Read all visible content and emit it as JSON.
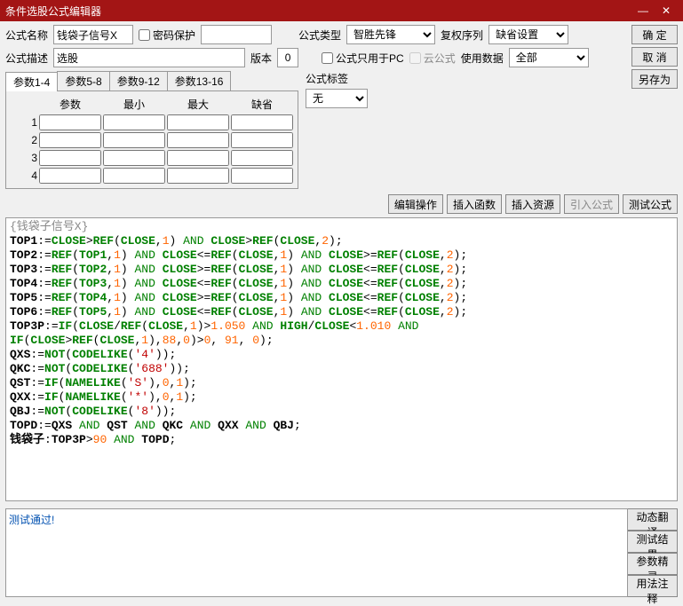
{
  "window": {
    "title": "条件选股公式编辑器"
  },
  "labels": {
    "name": "公式名称",
    "pwd": "密码保护",
    "type": "公式类型",
    "right": "复权序列",
    "desc": "公式描述",
    "ver": "版本",
    "pconly": "公式只用于PC",
    "cloud": "云公式",
    "usedata": "使用数据",
    "tag": "公式标签",
    "param": "参数",
    "min": "最小",
    "max": "最大",
    "def": "缺省"
  },
  "values": {
    "name": "钱袋子信号X",
    "desc": "选股",
    "ver": "0",
    "type": "智胜先锋",
    "right": "缺省设置",
    "usedata": "全部",
    "tag": "无"
  },
  "buttons": {
    "ok": "确 定",
    "cancel": "取 消",
    "saveas": "另存为",
    "editop": "编辑操作",
    "insfun": "插入函数",
    "insres": "插入资源",
    "impf": "引入公式",
    "testf": "测试公式",
    "dyntr": "动态翻译",
    "testres": "测试结果",
    "parwiz": "参数精灵",
    "usage": "用法注释"
  },
  "tabs": [
    "参数1-4",
    "参数5-8",
    "参数9-12",
    "参数13-16"
  ],
  "test_output": "测试通过!",
  "code_title": "{钱袋子信号X}",
  "code": [
    [
      [
        "id",
        "TOP1"
      ],
      [
        "op",
        ":="
      ],
      [
        "f",
        "CLOSE"
      ],
      [
        "op",
        ">"
      ],
      [
        "f",
        "REF"
      ],
      [
        "op",
        "("
      ],
      [
        "f",
        "CLOSE"
      ],
      [
        "op",
        ","
      ],
      [
        "n",
        "1"
      ],
      [
        "op",
        ") "
      ],
      [
        "k",
        "AND"
      ],
      [
        "op",
        " "
      ],
      [
        "f",
        "CLOSE"
      ],
      [
        "op",
        ">"
      ],
      [
        "f",
        "REF"
      ],
      [
        "op",
        "("
      ],
      [
        "f",
        "CLOSE"
      ],
      [
        "op",
        ","
      ],
      [
        "n",
        "2"
      ],
      [
        "op",
        ");"
      ]
    ],
    [
      [
        "id",
        "TOP2"
      ],
      [
        "op",
        ":="
      ],
      [
        "f",
        "REF"
      ],
      [
        "op",
        "("
      ],
      [
        "f",
        "TOP1"
      ],
      [
        "op",
        ","
      ],
      [
        "n",
        "1"
      ],
      [
        "op",
        ") "
      ],
      [
        "k",
        "AND"
      ],
      [
        "op",
        " "
      ],
      [
        "f",
        "CLOSE"
      ],
      [
        "op",
        "<="
      ],
      [
        "f",
        "REF"
      ],
      [
        "op",
        "("
      ],
      [
        "f",
        "CLOSE"
      ],
      [
        "op",
        ","
      ],
      [
        "n",
        "1"
      ],
      [
        "op",
        ") "
      ],
      [
        "k",
        "AND"
      ],
      [
        "op",
        " "
      ],
      [
        "f",
        "CLOSE"
      ],
      [
        "op",
        ">="
      ],
      [
        "f",
        "REF"
      ],
      [
        "op",
        "("
      ],
      [
        "f",
        "CLOSE"
      ],
      [
        "op",
        ","
      ],
      [
        "n",
        "2"
      ],
      [
        "op",
        ");"
      ]
    ],
    [
      [
        "id",
        "TOP3"
      ],
      [
        "op",
        ":="
      ],
      [
        "f",
        "REF"
      ],
      [
        "op",
        "("
      ],
      [
        "f",
        "TOP2"
      ],
      [
        "op",
        ","
      ],
      [
        "n",
        "1"
      ],
      [
        "op",
        ") "
      ],
      [
        "k",
        "AND"
      ],
      [
        "op",
        " "
      ],
      [
        "f",
        "CLOSE"
      ],
      [
        "op",
        ">="
      ],
      [
        "f",
        "REF"
      ],
      [
        "op",
        "("
      ],
      [
        "f",
        "CLOSE"
      ],
      [
        "op",
        ","
      ],
      [
        "n",
        "1"
      ],
      [
        "op",
        ") "
      ],
      [
        "k",
        "AND"
      ],
      [
        "op",
        " "
      ],
      [
        "f",
        "CLOSE"
      ],
      [
        "op",
        "<="
      ],
      [
        "f",
        "REF"
      ],
      [
        "op",
        "("
      ],
      [
        "f",
        "CLOSE"
      ],
      [
        "op",
        ","
      ],
      [
        "n",
        "2"
      ],
      [
        "op",
        ");"
      ]
    ],
    [
      [
        "id",
        "TOP4"
      ],
      [
        "op",
        ":="
      ],
      [
        "f",
        "REF"
      ],
      [
        "op",
        "("
      ],
      [
        "f",
        "TOP3"
      ],
      [
        "op",
        ","
      ],
      [
        "n",
        "1"
      ],
      [
        "op",
        ") "
      ],
      [
        "k",
        "AND"
      ],
      [
        "op",
        " "
      ],
      [
        "f",
        "CLOSE"
      ],
      [
        "op",
        "<="
      ],
      [
        "f",
        "REF"
      ],
      [
        "op",
        "("
      ],
      [
        "f",
        "CLOSE"
      ],
      [
        "op",
        ","
      ],
      [
        "n",
        "1"
      ],
      [
        "op",
        ") "
      ],
      [
        "k",
        "AND"
      ],
      [
        "op",
        " "
      ],
      [
        "f",
        "CLOSE"
      ],
      [
        "op",
        "<="
      ],
      [
        "f",
        "REF"
      ],
      [
        "op",
        "("
      ],
      [
        "f",
        "CLOSE"
      ],
      [
        "op",
        ","
      ],
      [
        "n",
        "2"
      ],
      [
        "op",
        ");"
      ]
    ],
    [
      [
        "id",
        "TOP5"
      ],
      [
        "op",
        ":="
      ],
      [
        "f",
        "REF"
      ],
      [
        "op",
        "("
      ],
      [
        "f",
        "TOP4"
      ],
      [
        "op",
        ","
      ],
      [
        "n",
        "1"
      ],
      [
        "op",
        ") "
      ],
      [
        "k",
        "AND"
      ],
      [
        "op",
        " "
      ],
      [
        "f",
        "CLOSE"
      ],
      [
        "op",
        ">="
      ],
      [
        "f",
        "REF"
      ],
      [
        "op",
        "("
      ],
      [
        "f",
        "CLOSE"
      ],
      [
        "op",
        ","
      ],
      [
        "n",
        "1"
      ],
      [
        "op",
        ") "
      ],
      [
        "k",
        "AND"
      ],
      [
        "op",
        " "
      ],
      [
        "f",
        "CLOSE"
      ],
      [
        "op",
        "<="
      ],
      [
        "f",
        "REF"
      ],
      [
        "op",
        "("
      ],
      [
        "f",
        "CLOSE"
      ],
      [
        "op",
        ","
      ],
      [
        "n",
        "2"
      ],
      [
        "op",
        ");"
      ]
    ],
    [
      [
        "id",
        "TOP6"
      ],
      [
        "op",
        ":="
      ],
      [
        "f",
        "REF"
      ],
      [
        "op",
        "("
      ],
      [
        "f",
        "TOP5"
      ],
      [
        "op",
        ","
      ],
      [
        "n",
        "1"
      ],
      [
        "op",
        ") "
      ],
      [
        "k",
        "AND"
      ],
      [
        "op",
        " "
      ],
      [
        "f",
        "CLOSE"
      ],
      [
        "op",
        "<="
      ],
      [
        "f",
        "REF"
      ],
      [
        "op",
        "("
      ],
      [
        "f",
        "CLOSE"
      ],
      [
        "op",
        ","
      ],
      [
        "n",
        "1"
      ],
      [
        "op",
        ") "
      ],
      [
        "k",
        "AND"
      ],
      [
        "op",
        " "
      ],
      [
        "f",
        "CLOSE"
      ],
      [
        "op",
        "<="
      ],
      [
        "f",
        "REF"
      ],
      [
        "op",
        "("
      ],
      [
        "f",
        "CLOSE"
      ],
      [
        "op",
        ","
      ],
      [
        "n",
        "2"
      ],
      [
        "op",
        ");"
      ]
    ],
    [
      [
        "id",
        "TOP3P"
      ],
      [
        "op",
        ":="
      ],
      [
        "f",
        "IF"
      ],
      [
        "op",
        "("
      ],
      [
        "f",
        "CLOSE"
      ],
      [
        "op",
        "/"
      ],
      [
        "f",
        "REF"
      ],
      [
        "op",
        "("
      ],
      [
        "f",
        "CLOSE"
      ],
      [
        "op",
        ","
      ],
      [
        "n",
        "1"
      ],
      [
        "op",
        ")>"
      ],
      [
        "n",
        "1.050"
      ],
      [
        "op",
        " "
      ],
      [
        "k",
        "AND"
      ],
      [
        "op",
        " "
      ],
      [
        "f",
        "HIGH"
      ],
      [
        "op",
        "/"
      ],
      [
        "f",
        "CLOSE"
      ],
      [
        "op",
        "<"
      ],
      [
        "n",
        "1.010"
      ],
      [
        "op",
        " "
      ],
      [
        "k",
        "AND"
      ]
    ],
    [
      [
        "f",
        "IF"
      ],
      [
        "op",
        "("
      ],
      [
        "f",
        "CLOSE"
      ],
      [
        "op",
        ">"
      ],
      [
        "f",
        "REF"
      ],
      [
        "op",
        "("
      ],
      [
        "f",
        "CLOSE"
      ],
      [
        "op",
        ","
      ],
      [
        "n",
        "1"
      ],
      [
        "op",
        "),"
      ],
      [
        "n",
        "88"
      ],
      [
        "op",
        ","
      ],
      [
        "n",
        "0"
      ],
      [
        "op",
        ")>"
      ],
      [
        "n",
        "0"
      ],
      [
        "op",
        ", "
      ],
      [
        "n",
        "91"
      ],
      [
        "op",
        ", "
      ],
      [
        "n",
        "0"
      ],
      [
        "op",
        ");"
      ]
    ],
    [
      [
        "id",
        "QXS"
      ],
      [
        "op",
        ":="
      ],
      [
        "f",
        "NOT"
      ],
      [
        "op",
        "("
      ],
      [
        "f",
        "CODELIKE"
      ],
      [
        "op",
        "("
      ],
      [
        "s",
        "'4'"
      ],
      [
        "op",
        "));"
      ]
    ],
    [
      [
        "id",
        "QKC"
      ],
      [
        "op",
        ":="
      ],
      [
        "f",
        "NOT"
      ],
      [
        "op",
        "("
      ],
      [
        "f",
        "CODELIKE"
      ],
      [
        "op",
        "("
      ],
      [
        "s",
        "'688'"
      ],
      [
        "op",
        "));"
      ]
    ],
    [
      [
        "id",
        "QST"
      ],
      [
        "op",
        ":="
      ],
      [
        "f",
        "IF"
      ],
      [
        "op",
        "("
      ],
      [
        "f",
        "NAMELIKE"
      ],
      [
        "op",
        "("
      ],
      [
        "s",
        "'S'"
      ],
      [
        "op",
        "),"
      ],
      [
        "n",
        "0"
      ],
      [
        "op",
        ","
      ],
      [
        "n",
        "1"
      ],
      [
        "op",
        ");"
      ]
    ],
    [
      [
        "id",
        "QXX"
      ],
      [
        "op",
        ":="
      ],
      [
        "f",
        "IF"
      ],
      [
        "op",
        "("
      ],
      [
        "f",
        "NAMELIKE"
      ],
      [
        "op",
        "("
      ],
      [
        "s",
        "'*'"
      ],
      [
        "op",
        "),"
      ],
      [
        "n",
        "0"
      ],
      [
        "op",
        ","
      ],
      [
        "n",
        "1"
      ],
      [
        "op",
        ");"
      ]
    ],
    [
      [
        "id",
        "QBJ"
      ],
      [
        "op",
        ":="
      ],
      [
        "f",
        "NOT"
      ],
      [
        "op",
        "("
      ],
      [
        "f",
        "CODELIKE"
      ],
      [
        "op",
        "("
      ],
      [
        "s",
        "'8'"
      ],
      [
        "op",
        "));"
      ]
    ],
    [
      [
        "id",
        "TOPD"
      ],
      [
        "op",
        ":="
      ],
      [
        "id",
        "QXS"
      ],
      [
        "op",
        " "
      ],
      [
        "k",
        "AND"
      ],
      [
        "op",
        " "
      ],
      [
        "id",
        "QST"
      ],
      [
        "op",
        " "
      ],
      [
        "k",
        "AND"
      ],
      [
        "op",
        " "
      ],
      [
        "id",
        "QKC"
      ],
      [
        "op",
        " "
      ],
      [
        "k",
        "AND"
      ],
      [
        "op",
        " "
      ],
      [
        "id",
        "QXX"
      ],
      [
        "op",
        " "
      ],
      [
        "k",
        "AND"
      ],
      [
        "op",
        " "
      ],
      [
        "id",
        "QBJ"
      ],
      [
        "op",
        ";"
      ]
    ],
    [
      [
        "id",
        "钱袋子"
      ],
      [
        "op",
        ":"
      ],
      [
        "id",
        "TOP3P"
      ],
      [
        "op",
        ">"
      ],
      [
        "n",
        "90"
      ],
      [
        "op",
        " "
      ],
      [
        "k",
        "AND"
      ],
      [
        "op",
        " "
      ],
      [
        "id",
        "TOPD"
      ],
      [
        "op",
        ";"
      ]
    ]
  ]
}
